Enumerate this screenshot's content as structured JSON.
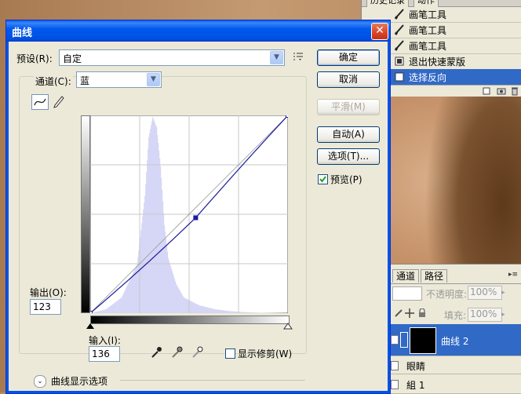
{
  "history": {
    "tabs": [
      "历史记录",
      "动作"
    ],
    "items": [
      {
        "label": "画笔工具",
        "selected": false
      },
      {
        "label": "画笔工具",
        "selected": false
      },
      {
        "label": "画笔工具",
        "selected": false
      },
      {
        "label": "退出快速蒙版",
        "selected": false
      },
      {
        "label": "选择反向",
        "selected": true
      }
    ]
  },
  "layers_panel": {
    "tabs": [
      "通道",
      "路径"
    ],
    "opacity_label": "不透明度:",
    "opacity_value": "100%",
    "fill_label": "填充:",
    "fill_value": "100%",
    "layers": [
      {
        "name": "曲线 2",
        "selected": true
      },
      {
        "name": "眼睛",
        "selected": false
      },
      {
        "name": "組 1",
        "selected": false
      }
    ]
  },
  "dialog": {
    "title": "曲线",
    "preset_label": "预设(R):",
    "preset_value": "自定",
    "channel_label": "通道(C):",
    "channel_value": "蓝",
    "output_label": "输出(O):",
    "output_value": "123",
    "input_label": "输入(I):",
    "input_value": "136",
    "show_clipping_label": "显示修剪(W)",
    "show_clipping_checked": false,
    "curve_display_options_label": "曲线显示选项",
    "buttons": {
      "ok": "确定",
      "cancel": "取消",
      "smooth": "平滑(M)",
      "auto": "自动(A)",
      "options": "选项(T)..."
    },
    "preview_label": "预览(P)",
    "preview_checked": true
  },
  "colors": {
    "titlebar": "#0058ee",
    "curve": "#1a1aa0",
    "histogram": "#d6d6f6",
    "selection": "#3169c6"
  },
  "chart_data": {
    "type": "area",
    "x": [
      0,
      20,
      40,
      60,
      70,
      75,
      80,
      85,
      90,
      95,
      100,
      110,
      120,
      140,
      160,
      180,
      200,
      220,
      255
    ],
    "values": [
      0,
      2,
      8,
      25,
      60,
      90,
      100,
      95,
      75,
      45,
      28,
      15,
      8,
      4,
      2,
      1,
      0.5,
      0.2,
      0
    ],
    "curve_points": [
      [
        0,
        0
      ],
      [
        136,
        123
      ],
      [
        255,
        255
      ]
    ],
    "xlim": [
      0,
      255
    ],
    "ylim": [
      0,
      255
    ],
    "grid": true
  }
}
